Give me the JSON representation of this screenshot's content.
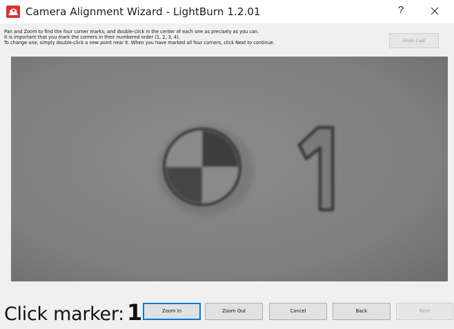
{
  "window": {
    "title": "Camera Alignment Wizard - LightBurn 1.2.01",
    "help_label": "?"
  },
  "instructions": [
    "Pan and Zoom to find the four corner marks, and double-click in the center of each one as precisely as you can.",
    "It is important that you mark the corners in their numbered order (1, 2, 3, 4).",
    "To change one, simply double-click a new point near it.  When you have marked all four corners, click Next to continue."
  ],
  "undo_label": "Undo Last",
  "camera": {
    "visible_marker_number": "1"
  },
  "marker": {
    "label": "Click marker:",
    "number": "1"
  },
  "buttons": {
    "zoom_in": "Zoom In",
    "zoom_out": "Zoom Out",
    "cancel": "Cancel",
    "back": "Back",
    "next": "Next"
  },
  "colors": {
    "focus": "#0078d7",
    "app_icon": "#d9342b"
  }
}
